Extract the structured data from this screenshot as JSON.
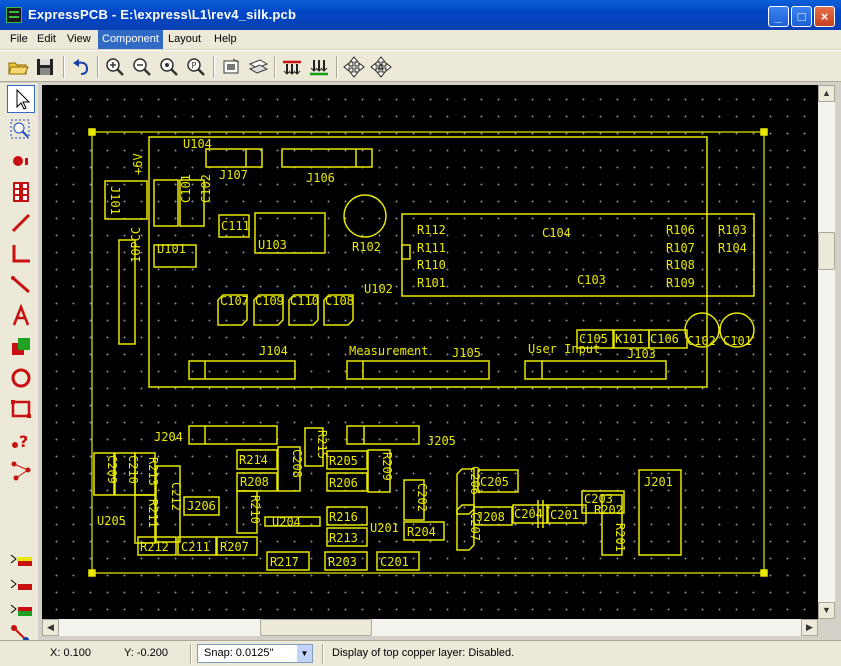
{
  "window": {
    "title": "ExpressPCB - E:\\express\\L1\\rev4_silk.pcb",
    "minimize": "_",
    "maximize": "□",
    "close": "×"
  },
  "menu": [
    "File",
    "Edit",
    "View",
    "Component",
    "Layout",
    "Help"
  ],
  "menu_active": "Component",
  "toolbar": [
    "open-icon",
    "save-icon",
    "undo-icon",
    "zoom-in-icon",
    "zoom-out-icon",
    "zoom-window-icon",
    "zoom-fit-icon",
    "properties-icon",
    "layer-icon",
    "top-pads-icon",
    "bottom-pads-icon",
    "move-icon",
    "auto-move-icon"
  ],
  "palette": [
    "select-pointer-icon",
    "zoom-select-icon",
    "pad-icon",
    "component-icon",
    "trace-icon",
    "trace-angle-icon",
    "trace-diagonal-icon",
    "text-icon",
    "filled-plane-icon",
    "circle-icon",
    "rectangle-icon",
    "query-icon",
    "net-icon",
    "layer-top-icon",
    "layer-bottom-icon",
    "layer-silk-icon",
    "connection-icon"
  ],
  "board": {
    "labels": [
      "U104",
      "J107",
      "J106",
      "+6V",
      "J101",
      "C101",
      "C102",
      "C111",
      "U103",
      "R102",
      "R112",
      "R111",
      "R110",
      "R101",
      "C104",
      "R106",
      "R107",
      "R108",
      "R109",
      "R103",
      "R104",
      "U101",
      "10PCC",
      "C103",
      "U102",
      "C107",
      "C109",
      "C110",
      "C108",
      "C105",
      "K101",
      "C106",
      "C102",
      "C101",
      "J104",
      "Measurement",
      "J105",
      "User Input",
      "J103",
      "J204",
      "J205",
      "R215",
      "R214",
      "C208",
      "R205",
      "R209",
      "R208",
      "R206",
      "C209",
      "C210",
      "R213",
      "C212",
      "J206",
      "R211",
      "R210",
      "U205",
      "U204",
      "R216",
      "R213",
      "U201",
      "C202",
      "R204",
      "C206",
      "C205",
      "J208",
      "C204",
      "C201",
      "C203",
      "R201",
      "R202",
      "J201",
      "R212",
      "C211",
      "R207",
      "C207",
      "R217",
      "R203",
      "C201"
    ]
  },
  "status": {
    "x": "X: 0.100",
    "y": "Y: -0.200",
    "snap": "Snap:  0.0125\"",
    "message": "Display of top copper layer:  Disabled."
  },
  "colors": {
    "silk": "#e8e800",
    "canvas": "#000000",
    "grid": "#8a8a8a"
  }
}
